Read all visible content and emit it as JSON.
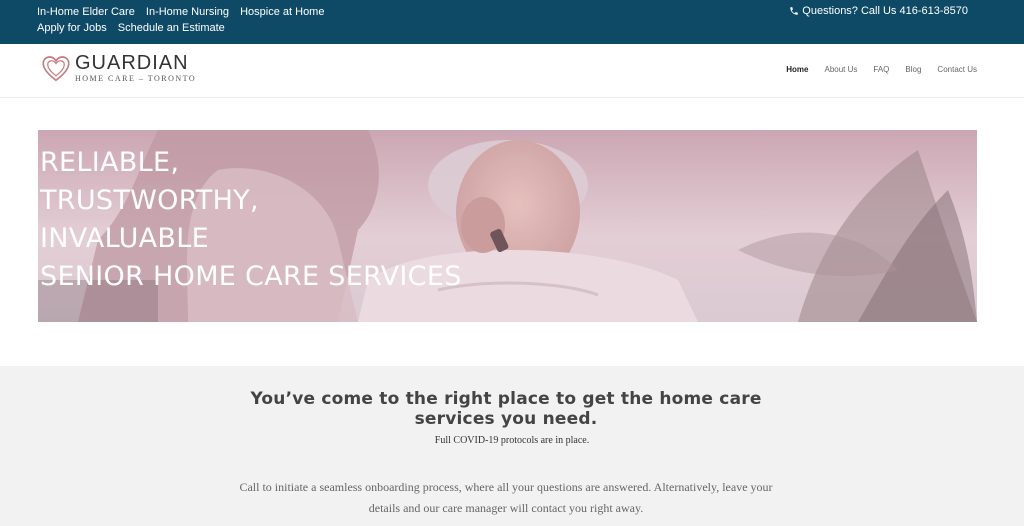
{
  "topbar": {
    "links": [
      "In-Home Elder Care",
      "In-Home Nursing",
      "Hospice at Home",
      "Apply for Jobs",
      "Schedule an Estimate"
    ],
    "phone_icon": "phone-icon",
    "phone_text": "Questions? Call Us 416-613-8570",
    "background": "#0e4a66"
  },
  "header": {
    "logo_name": "GUARDIAN",
    "logo_sub": "HOME CARE – TORONTO",
    "logo_icon": "heart-icon",
    "accent": "#c47c80",
    "nav": [
      "Home",
      "About Us",
      "FAQ",
      "Blog",
      "Contact Us"
    ],
    "active_nav": "Home"
  },
  "hero": {
    "lines": [
      "RELIABLE,",
      "TRUSTWORTHY,",
      "INVALUABLE",
      "SENIOR HOME CARE SERVICES"
    ]
  },
  "content": {
    "headline": "You’ve come to the right place to get the home care services you need.",
    "subhead": "Full COVID-19 protocols are in place.",
    "body": "Call to initiate a seamless onboarding process, where all your questions are answered. Alternatively, leave your details and our care manager will contact you right away."
  }
}
